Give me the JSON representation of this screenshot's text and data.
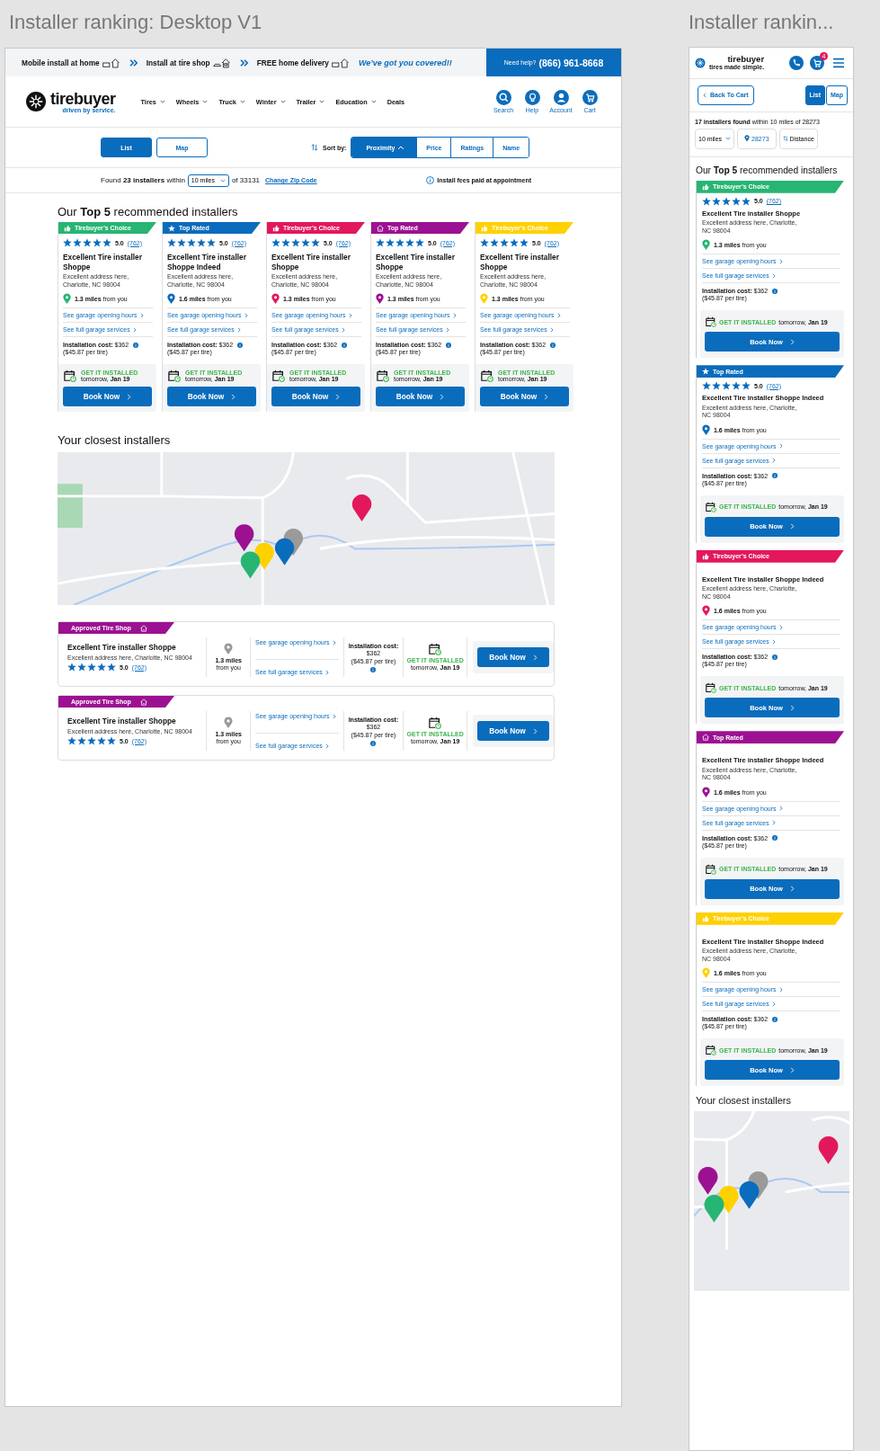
{
  "desktop": {
    "title": "Installer ranking: Desktop V1",
    "promo": [
      {
        "label": "Mobile install at home",
        "kind": "van"
      },
      {
        "label": "Install at tire shop",
        "kind": "shop"
      },
      {
        "label": "FREE home delivery",
        "kind": "truck"
      }
    ],
    "tagline": "We’ve got you covered!!",
    "help": {
      "label": "Need help?",
      "phone": "(866) 961-8668"
    },
    "logo": {
      "name": "tirebuyer",
      "tagline": "driven by service."
    },
    "nav": [
      {
        "label": "Tires",
        "dropdown": true
      },
      {
        "label": "Wheels",
        "dropdown": true
      },
      {
        "label": "Truck",
        "dropdown": true
      },
      {
        "label": "Winter",
        "dropdown": true
      },
      {
        "label": "Trailer",
        "dropdown": true
      },
      {
        "label": "Education",
        "dropdown": true
      },
      {
        "label": "Deals",
        "dropdown": false
      }
    ],
    "header_icons": [
      {
        "label": "Search",
        "kind": "search"
      },
      {
        "label": "Help",
        "kind": "help"
      },
      {
        "label": "Account",
        "kind": "account"
      },
      {
        "label": "Cart",
        "kind": "cart"
      }
    ],
    "view_toggle": [
      {
        "label": "List",
        "selected": true
      },
      {
        "label": "Map",
        "selected": false
      }
    ],
    "sort": {
      "label": "Sort by:",
      "options": [
        {
          "label": "Proximity",
          "selected": true
        },
        {
          "label": "Price",
          "selected": false
        },
        {
          "label": "Ratings",
          "selected": false
        },
        {
          "label": "Name",
          "selected": false
        }
      ]
    },
    "found": {
      "text": "Found **23 installers** within",
      "radius": "10 miles",
      "zip": "of 33131",
      "link": "Change Zip Code"
    },
    "fees_note": "Install fees paid at appointment",
    "top_heading": "Our **Top 5** recommended installers",
    "cards": [
      {
        "badge": "Tirebuyer’s Choice",
        "kind": "thumb",
        "color": "#27b573",
        "stars": 5,
        "rating": "5.0",
        "reviews": "(762)",
        "name": "Excellent Tire installer Shoppe",
        "address": "Excellent address here, Charlotte, NC 98004",
        "distance": "**1.3 miles** from you",
        "hours": "See garage opening hours",
        "services": "See full garage services",
        "cost": "**Installation cost:** $362",
        "per_tire": "($45.87 per tire)",
        "install_label": "GET IT INSTALLED",
        "install_when": "tomorrow, **Jan 19**",
        "button": "Book Now"
      },
      {
        "badge": "Top Rated",
        "kind": "star",
        "color": "#0a6cbc",
        "stars": 5,
        "rating": "5.0",
        "reviews": "(762)",
        "name": "Excellent Tire installer Shoppe Indeed",
        "address": "Excellent address here, Charlotte, NC 98004",
        "distance": "**1.6 miles** from you",
        "hours": "See garage opening hours",
        "services": "See full garage services",
        "cost": "**Installation cost:** $362",
        "per_tire": "($45.87 per tire)",
        "install_label": "GET IT INSTALLED",
        "install_when": "tomorrow, **Jan 19**",
        "button": "Book Now"
      },
      {
        "badge": "Tirebuyer’s Choice",
        "kind": "thumb",
        "color": "#e3185c",
        "stars": 5,
        "rating": "5.0",
        "reviews": "(762)",
        "name": "Excellent Tire installer Shoppe",
        "address": "Excellent address here, Charlotte, NC 98004",
        "distance": "**1.3 miles** from you",
        "hours": "See garage opening hours",
        "services": "See full garage services",
        "cost": "**Installation cost:** $362",
        "per_tire": "($45.87 per tire)",
        "install_label": "GET IT INSTALLED",
        "install_when": "tomorrow, **Jan 19**",
        "button": "Book Now"
      },
      {
        "badge": "Top Rated",
        "kind": "house",
        "color": "#9c1192",
        "stars": 5,
        "rating": "5.0",
        "reviews": "(762)",
        "name": "Excellent Tire installer Shoppe",
        "address": "Excellent address here, Charlotte, NC 98004",
        "distance": "**1.3 miles** from you",
        "hours": "See garage opening hours",
        "services": "See full garage services",
        "cost": "**Installation cost:** $362",
        "per_tire": "($45.87 per tire)",
        "install_label": "GET IT INSTALLED",
        "install_when": "tomorrow, **Jan 19**",
        "button": "Book Now"
      },
      {
        "badge": "Tirebuyer’s Choice",
        "kind": "thumb",
        "color": "#ffd100",
        "stars": 5,
        "rating": "5.0",
        "reviews": "(762)",
        "name": "Excellent Tire installer Shoppe",
        "address": "Excellent address here, Charlotte, NC 98004",
        "distance": "**1.3 miles** from you",
        "hours": "See garage opening hours",
        "services": "See full garage services",
        "cost": "**Installation cost:** $362",
        "per_tire": "($45.87 per tire)",
        "install_label": "GET IT INSTALLED",
        "install_when": "tomorrow, **Jan 19**",
        "button": "Book Now"
      }
    ],
    "closest_heading": "Your closest installers",
    "rows": [
      {
        "badge": "Approved Tire Shop",
        "name": "Excellent Tire installer Shoppe",
        "address": "Excellent address here, Charlotte, NC 98004",
        "stars": 5,
        "rating": "5.0",
        "reviews": "(762)",
        "distance": "1.3 miles",
        "distance_suffix": "from you",
        "hours": "See garage opening hours",
        "services": "See full garage services",
        "cost_label": "Installation cost:",
        "cost": "$362",
        "per_tire": "($45.87 per tire)",
        "install_label": "GET IT INSTALLED",
        "install_when": "tomorrow, **Jan 19**",
        "button": "Book Now"
      },
      {
        "badge": "Approved Tire Shop",
        "name": "Excellent Tire installer Shoppe",
        "address": "Excellent address here, Charlotte, NC 98004",
        "stars": 5,
        "rating": "5.0",
        "reviews": "(762)",
        "distance": "1.3 miles",
        "distance_suffix": "from you",
        "hours": "See garage opening hours",
        "services": "See full garage services",
        "cost_label": "Installation cost:",
        "cost": "$362",
        "per_tire": "($45.87 per tire)",
        "install_label": "GET IT INSTALLED",
        "install_when": "tomorrow, **Jan 19**",
        "button": "Book Now"
      }
    ]
  },
  "mobile": {
    "title": "Installer rankin...",
    "logo": {
      "name": "tirebuyer",
      "tagline": "tires made simple."
    },
    "cart_count": "4",
    "back": "Back To Cart",
    "view_toggle": [
      {
        "label": "List",
        "selected": true
      },
      {
        "label": "Map",
        "selected": false
      }
    ],
    "found": "**17 installers found** within 10 miles of 28273",
    "filters": [
      {
        "label": "10 miles",
        "kind": "dropdown"
      },
      {
        "label": "28273",
        "kind": "location"
      },
      {
        "label": "Distance",
        "kind": "sort"
      }
    ],
    "top_heading": "Our **Top 5** recommended installers",
    "cards": [
      {
        "badge": "Tirebuyer’s Choice",
        "kind": "thumb",
        "color": "#27b573",
        "stars": 5,
        "rating": "5.0",
        "reviews": "(762)",
        "name": "Excellent Tire installer Shoppe",
        "address": "Excellent address here, Charlotte, NC 98004",
        "distance": "**1.3 miles** from you",
        "hours": "See garage opening hours",
        "services": "See full garage services",
        "cost": "**Installation cost:** $362",
        "per_tire": "($45.87 per tire)",
        "install_label": "GET IT INSTALLED",
        "install_when": "tomorrow, **Jan 19**",
        "button": "Book Now"
      },
      {
        "badge": "Top Rated",
        "kind": "star",
        "color": "#0a6cbc",
        "stars": 5,
        "rating": "5.0",
        "reviews": "(762)",
        "name": "Excellent Tire installer Shoppe Indeed",
        "address": "Excellent address here, Charlotte, NC 98004",
        "distance": "**1.6 miles** from you",
        "hours": "See garage opening hours",
        "services": "See full garage services",
        "cost": "**Installation cost:** $362",
        "per_tire": "($45.87 per tire)",
        "install_label": "GET IT INSTALLED",
        "install_when": "tomorrow, **Jan 19**",
        "button": "Book Now"
      },
      {
        "badge": "Tirebuyer’s Choice",
        "kind": "thumb",
        "color": "#e3185c",
        "name": "Excellent Tire installer Shoppe Indeed",
        "address": "Excellent address here, Charlotte, NC 98004",
        "distance": "**1.6 miles** from you",
        "hours": "See garage opening hours",
        "services": "See full garage services",
        "cost": "**Installation cost:** $362",
        "per_tire": "($45.87 per tire)",
        "install_label": "GET IT INSTALLED",
        "install_when": "tomorrow, **Jan 19**",
        "button": "Book Now"
      },
      {
        "badge": "Top Rated",
        "kind": "house",
        "color": "#9c1192",
        "name": "Excellent Tire installer Shoppe Indeed",
        "address": "Excellent address here, Charlotte, NC 98004",
        "distance": "**1.6 miles** from you",
        "hours": "See garage opening hours",
        "services": "See full garage services",
        "cost": "**Installation cost:** $362",
        "per_tire": "($45.87 per tire)",
        "install_label": "GET IT INSTALLED",
        "install_when": "tomorrow, **Jan 19**",
        "button": "Book Now"
      },
      {
        "badge": "Tirebuyer’s Choice",
        "kind": "thumb",
        "color": "#ffd100",
        "name": "Excellent Tire installer Shoppe Indeed",
        "address": "Excellent address here, Charlotte, NC 98004",
        "distance": "**1.6 miles** from you",
        "hours": "See garage opening hours",
        "services": "See full garage services",
        "cost": "**Installation cost:** $362",
        "per_tire": "($45.87 per tire)",
        "install_label": "GET IT INSTALLED",
        "install_when": "tomorrow, **Jan 19**",
        "button": "Book Now"
      }
    ],
    "closest_heading": "Your closest installers"
  }
}
